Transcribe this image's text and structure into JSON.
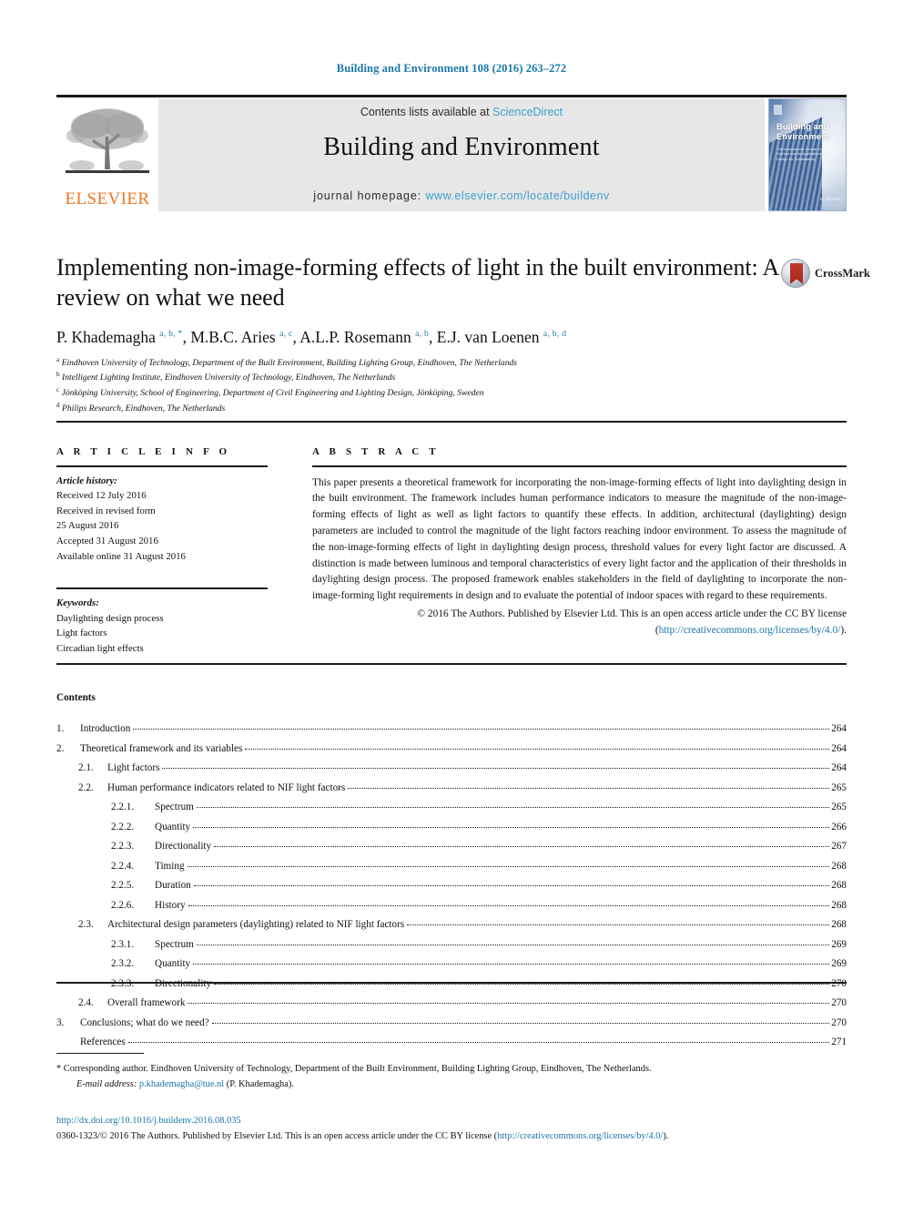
{
  "running_head": "Building and Environment 108 (2016) 263–272",
  "masthead": {
    "contents_prefix": "Contents lists available at ",
    "sciencedirect": "ScienceDirect",
    "journal_title": "Building and Environment",
    "homepage_prefix": "journal homepage: ",
    "homepage_url": "www.elsevier.com/locate/buildenv",
    "publisher_logo": "ELSEVIER",
    "cover_title": "Building and Environment",
    "cover_subtitle": "The International Journal of Building Science and its Applications Including Design for Sustainability",
    "cover_publisher": "ELSEVIER",
    "accent_blue": "#3f9fd0"
  },
  "article": {
    "title": "Implementing non-image-forming effects of light in the built environment: A review on what we need",
    "authors_html": "P. Khademagha <sup>a, b, *</sup>, M.B.C. Aries <sup>a, c</sup>, A.L.P. Rosemann <sup>a, b</sup>, E.J. van Loenen <sup>a, b, d</sup>",
    "affiliations": [
      {
        "mark": "a",
        "text": "Eindhoven University of Technology, Department of the Built Environment, Building Lighting Group, Eindhoven, The Netherlands"
      },
      {
        "mark": "b",
        "text": "Intelligent Lighting Institute, Eindhoven University of Technology, Eindhoven, The Netherlands"
      },
      {
        "mark": "c",
        "text": "Jönköping University, School of Engineering, Department of Civil Engineering and Lighting Design, Jönköping, Sweden"
      },
      {
        "mark": "d",
        "text": "Philips Research, Eindhoven, The Netherlands"
      }
    ],
    "crossmark_label": "CrossMark"
  },
  "article_info": {
    "heading": "A R T I C L E   I N F O",
    "history_label": "Article history:",
    "history_lines": [
      "Received 12 July 2016",
      "Received in revised form",
      "25 August 2016",
      "Accepted 31 August 2016",
      "Available online 31 August 2016"
    ],
    "keywords_label": "Keywords:",
    "keywords": [
      "Daylighting design process",
      "Light factors",
      "Circadian light effects"
    ]
  },
  "abstract": {
    "heading": "A B S T R A C T",
    "text": "This paper presents a theoretical framework for incorporating the non-image-forming effects of light into daylighting design in the built environment. The framework includes human performance indicators to measure the magnitude of the non-image-forming effects of light as well as light factors to quantify these effects. In addition, architectural (daylighting) design parameters are included to control the magnitude of the light factors reaching indoor environment. To assess the magnitude of the non-image-forming effects of light in daylighting design process, threshold values for every light factor are discussed. A distinction is made between luminous and temporal characteristics of every light factor and the application of their thresholds in daylighting design process. The proposed framework enables stakeholders in the field of daylighting to incorporate the non-image-forming light requirements in design and to evaluate the potential of indoor spaces with regard to these requirements.",
    "copyright": "© 2016 The Authors. Published by Elsevier Ltd. This is an open access article under the CC BY license",
    "license_open": "(",
    "license_url": "http://creativecommons.org/licenses/by/4.0/",
    "license_close": ")."
  },
  "contents": {
    "heading": "Contents",
    "items": [
      {
        "level": 1,
        "num": "1.",
        "label": "Introduction",
        "page": "264"
      },
      {
        "level": 1,
        "num": "2.",
        "label": "Theoretical framework and its variables",
        "page": "264"
      },
      {
        "level": 2,
        "num": "2.1.",
        "label": "Light factors",
        "page": "264"
      },
      {
        "level": 2,
        "num": "2.2.",
        "label": "Human performance indicators related to NIF light factors",
        "page": "265"
      },
      {
        "level": 3,
        "num": "2.2.1.",
        "label": "Spectrum",
        "page": "265"
      },
      {
        "level": 3,
        "num": "2.2.2.",
        "label": "Quantity",
        "page": "266"
      },
      {
        "level": 3,
        "num": "2.2.3.",
        "label": "Directionality",
        "page": "267"
      },
      {
        "level": 3,
        "num": "2.2.4.",
        "label": "Timing",
        "page": "268"
      },
      {
        "level": 3,
        "num": "2.2.5.",
        "label": "Duration",
        "page": "268"
      },
      {
        "level": 3,
        "num": "2.2.6.",
        "label": "History",
        "page": "268"
      },
      {
        "level": 2,
        "num": "2.3.",
        "label": "Architectural design parameters (daylighting) related to NIF light factors",
        "page": "268"
      },
      {
        "level": 3,
        "num": "2.3.1.",
        "label": "Spectrum",
        "page": "269"
      },
      {
        "level": 3,
        "num": "2.3.2.",
        "label": "Quantity",
        "page": "269"
      },
      {
        "level": 3,
        "num": "2.3.3.",
        "label": "Directionality",
        "page": "270"
      },
      {
        "level": 2,
        "num": "2.4.",
        "label": "Overall framework",
        "page": "270"
      },
      {
        "level": 1,
        "num": "3.",
        "label": "Conclusions; what do we need?",
        "page": "270"
      },
      {
        "level": 1,
        "num": "",
        "label": "References",
        "page": "271"
      }
    ]
  },
  "footnote": {
    "corresponding": "* Corresponding author. Eindhoven University of Technology, Department of the Built Environment, Building Lighting Group, Eindhoven, The Netherlands.",
    "email_label": "E-mail address:",
    "email": "p.khademagha@tue.nl",
    "email_suffix": "(P. Khademagha)."
  },
  "footer": {
    "doi": "http://dx.doi.org/10.1016/j.buildenv.2016.08.035",
    "issn_line_start": "0360-1323/© 2016 The Authors. Published by Elsevier Ltd. This is an open access article under the CC BY license (",
    "license_url": "http://creativecommons.org/licenses/by/4.0/",
    "issn_line_end": ")."
  }
}
